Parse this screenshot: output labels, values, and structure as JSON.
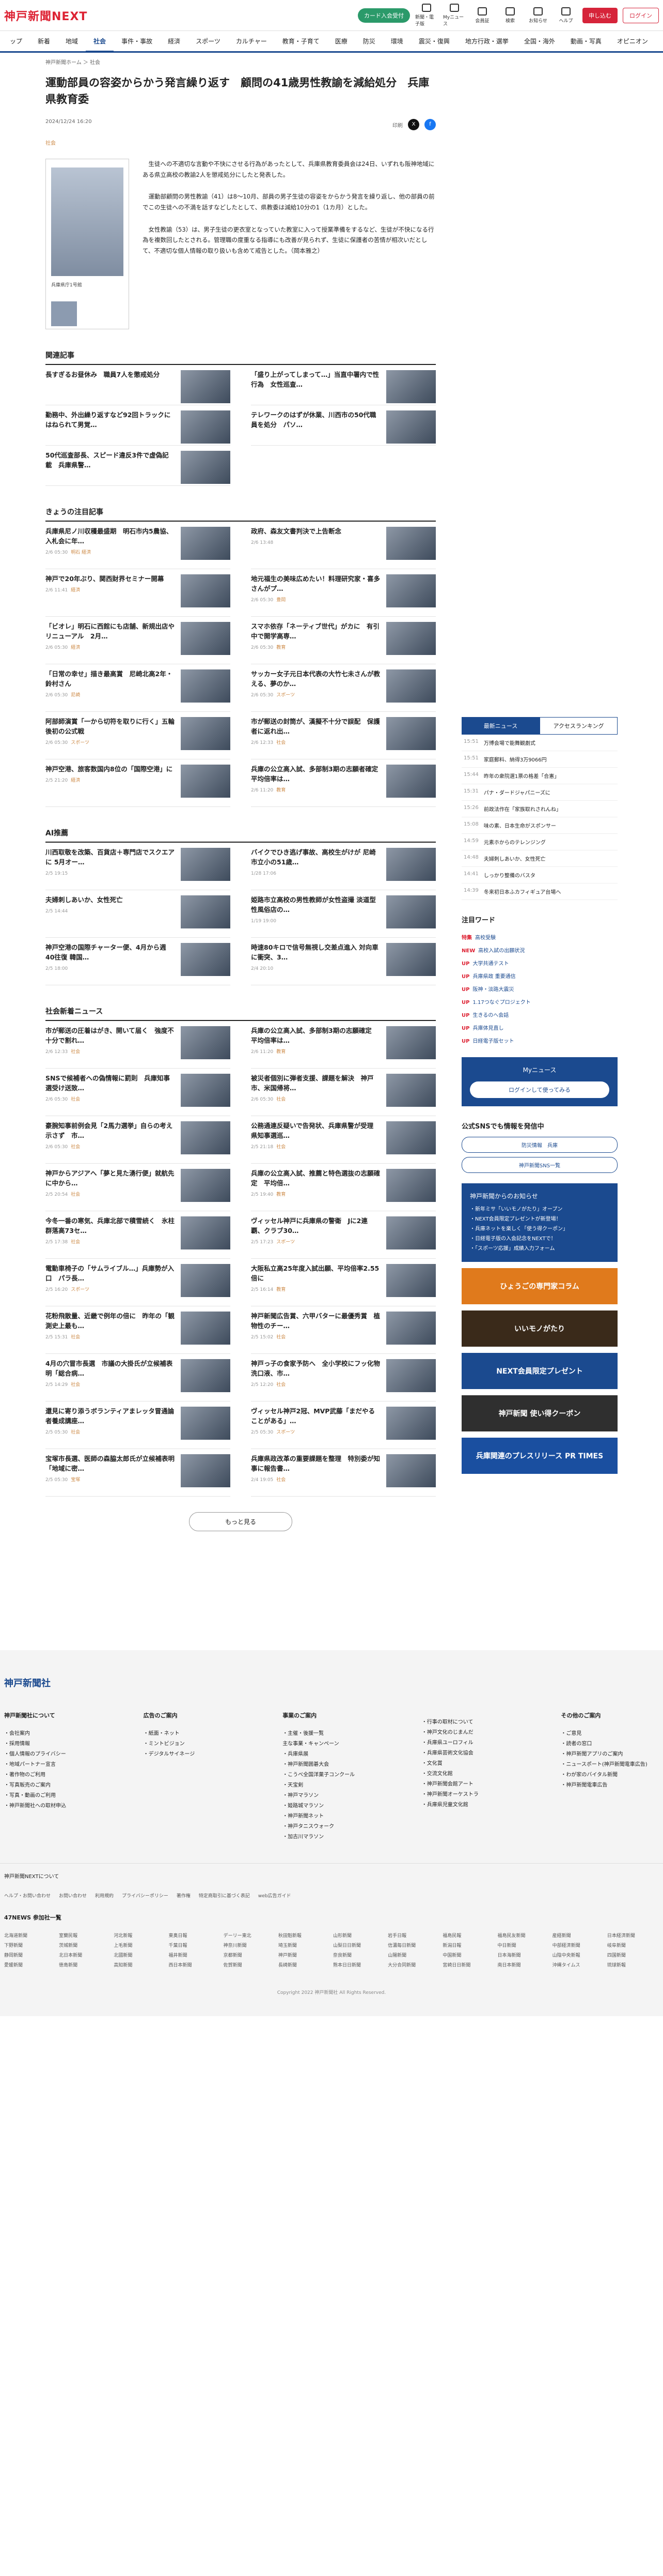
{
  "header": {
    "logo": "神戸新聞",
    "logo_accent": "NEXT",
    "pill": "カード入会受付",
    "icons": [
      {
        "label": "新聞・電子版",
        "icon": "newspaper-icon"
      },
      {
        "label": "Myニュース",
        "icon": "bookmark-icon"
      },
      {
        "label": "会員証",
        "icon": "card-icon"
      },
      {
        "label": "検索",
        "icon": "search-icon"
      },
      {
        "label": "お知らせ",
        "icon": "bell-icon"
      },
      {
        "label": "ヘルプ",
        "icon": "help-icon"
      }
    ],
    "signup": "申し込む",
    "login": "ログイン"
  },
  "nav": [
    "ップ",
    "新着",
    "地域",
    "社会",
    "事件・事故",
    "経済",
    "スポーツ",
    "カルチャー",
    "教育・子育て",
    "医療",
    "防災",
    "環境",
    "震災・復興",
    "地方行政・選挙",
    "全国・海外",
    "動画・写真",
    "オピニオン"
  ],
  "nav_active": "社会",
  "breadcrumb": "神戸新聞ホーム ＞ 社会",
  "article": {
    "title": "運動部員の容姿からかう発言繰り返す　顧問の41歳男性教諭を減給処分　兵庫県教育委",
    "date": "2024/12/24 16:20",
    "tag": "社会",
    "print": "印刷",
    "caption": "兵庫県庁1号館",
    "paragraphs": [
      "生徒への不適切な言動や不快にさせる行為があったとして、兵庫県教育委員会は24日、いずれも阪神地域にある県立高校の教諭2人を懲戒処分にしたと発表した。",
      "運動部顧問の男性教諭（41）は8～10月、部員の男子生徒の容姿をからかう発言を繰り返し、他の部員の前でこの生徒への不満を話すなどしたとして、県教委は減給10分の1（1カ月）とした。",
      "女性教諭（53）は、男子生徒の更衣室となっていた教室に入って授業準備をするなど、生徒が不快になる行為を複数回したとされる。管理職の度重なる指導にも改善が見られず、生徒に保護者の苦情が相次いだとして、不適切な個人情報の取り扱いも含めて戒告とした。（岡本雅之）"
    ]
  },
  "sections": [
    {
      "title": "関連記事",
      "items": [
        {
          "t": "長すぎるお昼休み　職員7人を懲戒処分",
          "d": "",
          "c": ""
        },
        {
          "t": "「盛り上がってしまって…」当直中署内で性行為　女性巡査…",
          "d": "",
          "c": ""
        },
        {
          "t": "勤務中、外出繰り返すなど92回トラックにはねられて男覚…",
          "d": "",
          "c": ""
        },
        {
          "t": "テレワークのはずが休業、川西市の50代職員を処分　パソ…",
          "d": "",
          "c": ""
        },
        {
          "t": "50代巡査部長、スピード違反3件で虚偽記載　兵庫県警…",
          "d": "",
          "c": ""
        }
      ]
    },
    {
      "title": "きょうの注目記事",
      "items": [
        {
          "t": "兵庫県尼ノ川収穫最盛期　明石市内5農協、入札会に年…",
          "d": "2/6 05:30",
          "c": "明石 経済"
        },
        {
          "t": "政府、森友文書判決で上告断念",
          "d": "2/6 13:48",
          "c": ""
        },
        {
          "t": "神戸で20年ぶり、関西財界セミナー開幕",
          "d": "2/6 11:41",
          "c": "経済"
        },
        {
          "t": "地元福生の美味広めたい！料理研究家・喜多さんがプ…",
          "d": "2/6 05:30",
          "c": "豊岡"
        },
        {
          "t": "「ビオレ」明石に西館にも店舗、新規出店やリニューアル　2月…",
          "d": "2/6 05:30",
          "c": "経済"
        },
        {
          "t": "スマホ依存「ネーティブ世代」がカに　有引中で開学高専…",
          "d": "2/6 05:30",
          "c": "教育"
        },
        {
          "t": "「日常の幸せ」描き最高賞　尼崎北高2年・鈴村さん",
          "d": "2/6 05:30",
          "c": "尼崎"
        },
        {
          "t": "サッカー女子元日本代表の大竹七未さんが教える、夢のか…",
          "d": "2/6 05:30",
          "c": "スポーツ"
        },
        {
          "t": "阿部師演賞「一から切符を取りに行く」五輪後初の公式戦",
          "d": "2/6 05:30",
          "c": "スポーツ"
        },
        {
          "t": "市が郵送の封筒が、漢擬不十分で誤配　保護者に返れ出…",
          "d": "2/6 12:33",
          "c": "社会"
        },
        {
          "t": "神戸空港、旅客数国内8位の「国際空港」に",
          "d": "2/5 21:20",
          "c": "経済"
        },
        {
          "t": "兵庫の公立高入試、多部制3期の志願者確定　平均倍率は…",
          "d": "2/6 11:20",
          "c": "教育"
        }
      ]
    },
    {
      "title": "AI推薦",
      "items": [
        {
          "t": "川西取敬を改築、百貨店＋専門店でスクエアに 5月オー…",
          "d": "2/5 19:15",
          "c": ""
        },
        {
          "t": "バイクでひき逃げ事故、高校生がけが 尼崎市立小の51歳…",
          "d": "1/28 17:06",
          "c": ""
        },
        {
          "t": "夫婦刺しあいか、女性死亡",
          "d": "2/5 14:44",
          "c": ""
        },
        {
          "t": "姫路市立高校の男性教師が女性盗撮 淡道型性風俗店の…",
          "d": "1/19 19:00",
          "c": ""
        },
        {
          "t": "神戸空港の国際チャーター便、4月から週40往復 韓国…",
          "d": "2/5 18:00",
          "c": ""
        },
        {
          "t": "時速80キロで信号無視し交差点進入 対向車に衝突、3…",
          "d": "2/4 20:10",
          "c": ""
        }
      ]
    },
    {
      "title": "社会新着ニュース",
      "items": [
        {
          "t": "市が郵送の圧着はがき、開いて届く　強度不十分で割れ…",
          "d": "2/6 12:33",
          "c": "社会"
        },
        {
          "t": "兵庫の公立高入試、多部制3期の志願確定　平均倍率は…",
          "d": "2/6 11:20",
          "c": "教育"
        },
        {
          "t": "SNSで候補者への偽情報に罰則　兵庫知事選受け送致…",
          "d": "2/6 05:30",
          "c": "社会"
        },
        {
          "t": "被災者個別に弾者支援、課題を解決　神戸市、米国帰将…",
          "d": "2/6 05:30",
          "c": "社会"
        },
        {
          "t": "豪腕知事前例会見「2馬力選挙」自らの考え示さず　市…",
          "d": "2/6 05:30",
          "c": "社会"
        },
        {
          "t": "公務通連反疑いで告発状、兵庫県警が受理　県知事選巡…",
          "d": "2/5 21:18",
          "c": "社会"
        },
        {
          "t": "神戸からアジアへ「夢と見た湧行便」就航先に中から…",
          "d": "2/5 20:54",
          "c": "社会"
        },
        {
          "t": "兵庫の公立高入試、推薦と特色選抜の志願確定　平均倍…",
          "d": "2/5 19:40",
          "c": "教育"
        },
        {
          "t": "今冬一番の寒気、兵庫北部で積雪続く　氷柱群落高73セ…",
          "d": "2/5 17:38",
          "c": "社会"
        },
        {
          "t": "ヴィッセル神戸に兵庫県の警衛　Jに2連覇、クラブ30…",
          "d": "2/5 17:23",
          "c": "スポーツ"
        },
        {
          "t": "電動車椅子の「サムライブル…」兵庫勢が入口　パラ長…",
          "d": "2/5 16:20",
          "c": "スポーツ"
        },
        {
          "t": "大阪私立高25年度入試出願、平均倍率2.55倍に",
          "d": "2/5 16:14",
          "c": "教育"
        },
        {
          "t": "花粉飛散量、近畿で例年の倍に　昨年の「観測史上最も…",
          "d": "2/5 15:31",
          "c": "社会"
        },
        {
          "t": "神戸新聞広告賞、六甲バターに最優秀賞　植物性のチー…",
          "d": "2/5 15:02",
          "c": "社会"
        },
        {
          "t": "4月の穴冒市長選　市議の大掛氏が立候補表明「総合病…",
          "d": "2/5 14:29",
          "c": "社会"
        },
        {
          "t": "神戸っ子の食家予防へ　全小学校にフッ化物洗口液、市…",
          "d": "2/5 12:20",
          "c": "社会"
        },
        {
          "t": "還見に寄り添うボランティアまレッタ冒通論者養成講座…",
          "d": "2/5 05:30",
          "c": "社会"
        },
        {
          "t": "ヴィッセル神戸2冠、MVP武藤「まだやることがある」…",
          "d": "2/5 05:30",
          "c": "スポーツ"
        },
        {
          "t": "宝塚市長選、医師の森脇太郎氏が立候補表明「地域に密…",
          "d": "2/5 05:30",
          "c": "宝塚"
        },
        {
          "t": "兵庫県政改革の重要課題を整理　特別委が知事に報告書…",
          "d": "2/4 19:05",
          "c": "社会"
        }
      ]
    }
  ],
  "more": "もっと見る",
  "side": {
    "tabs": [
      "最新ニュース",
      "アクセスランキング"
    ],
    "ranks": [
      {
        "time": "15:51",
        "t": "万博会場で能舞観劇式"
      },
      {
        "time": "15:51",
        "t": "家庭郵料、納得3万9066円"
      },
      {
        "time": "15:44",
        "t": "昨年の衆院選1票の格差「合憲」"
      },
      {
        "time": "15:31",
        "t": "パナ・ダードジャパニーズに"
      },
      {
        "time": "15:26",
        "t": "前政法作在「家族取れされんね」"
      },
      {
        "time": "15:08",
        "t": "味の素、日本生命がスポンサー"
      },
      {
        "time": "14:59",
        "t": "元素ホからのテレンジング"
      },
      {
        "time": "14:48",
        "t": "夫婦刺しあいか、女性死亡"
      },
      {
        "time": "14:41",
        "t": "しっかり整備のバスタ"
      },
      {
        "time": "14:39",
        "t": "冬来初日本ふカフィギュア台場へ"
      }
    ],
    "keywords_title": "注目ワード",
    "keywords": [
      {
        "b": "特集",
        "t": "高校受験"
      },
      {
        "b": "NEW",
        "t": "高校入試の出願状況"
      },
      {
        "b": "UP",
        "t": "大学共通テスト"
      },
      {
        "b": "UP",
        "t": "兵庫県政 重要通信"
      },
      {
        "b": "UP",
        "t": "阪神・淡路大震災"
      },
      {
        "b": "UP",
        "t": "1.17つなぐプロジェクト"
      },
      {
        "b": "UP",
        "t": "生きるのへ会話"
      },
      {
        "b": "UP",
        "t": "兵庫体見直し"
      },
      {
        "b": "UP",
        "t": "日経電子版セット"
      }
    ],
    "my_title": "Myニュース",
    "my_button": "ログインして使ってみる",
    "sns_title": "公式SNSでも情報を発信中",
    "sns_btns": [
      "防災情報　兵庫",
      "神戸新聞SNS一覧"
    ],
    "promo_title": "神戸新聞からのお知らせ",
    "promo": [
      "・新年ミサ「いいモノがたり」オープン",
      "・NEXT会員限定プレゼントが新登場！",
      "・兵庫ネットを楽しく「使う得クーポン」",
      "・日経電子版の入会記念をNEXTで！",
      "・「スポーツ応援」成績入力フォーム"
    ],
    "banners": [
      "ひょうごの専門家コラム",
      "いいモノがたり",
      "NEXT会員限定プレゼント",
      "神戸新聞 使い得クーポン",
      "兵庫関連のプレスリリース PR TIMES"
    ]
  },
  "footer": {
    "logo": "神戸新聞社",
    "cols": [
      {
        "h": "神戸新聞社について",
        "l": [
          "・会社案内",
          "・採用情報",
          "・個人情報のプライバシー",
          "",
          "・地域パートナー宣言",
          "・著作物のご利用",
          "・写真販売のご案内",
          "・写真・動画のご利用",
          "・神戸新聞社への取材申込"
        ]
      },
      {
        "h": "広告のご案内",
        "l": [
          "・紙面・ネット",
          "・ミントビジョン",
          "・デジタルサイネージ"
        ]
      },
      {
        "h": "事業のご案内",
        "l": [
          "・主催・後援一覧",
          "",
          "主な事業・キャンペーン",
          "・兵庫県展",
          "・神戸新聞囲碁大会",
          "・こうべ全国洋菓子コンクール",
          "・天宝剣",
          "・神戸マラソン",
          "・姫路城マラソン",
          "・神戸新聞ネット",
          "・神戸タニスウォーク",
          "・加古川マラソン"
        ]
      },
      {
        "h": "",
        "l": [
          "・行事の取材について",
          "",
          "",
          "・神戸文化のじまんだ",
          "・兵庫県ユーロフィル",
          "・兵庫県芸術文化協会",
          "・文化賞",
          "・交流文化館",
          "・神戸新聞会館アート",
          "・神戸新聞オーケストラ",
          "・兵庫県児童文化館"
        ]
      },
      {
        "h": "その他のご案内",
        "l": [
          "・ご意見",
          "・読者の窓口",
          "・神戸新聞アプリのご案内",
          "・ニュースポート(神戸新聞電車広告)",
          "・わが家のバイタル新聞",
          "・神戸新聞電車広告"
        ]
      }
    ],
    "next_title": "神戸新聞NEXTについて",
    "links": [
      "ヘルプ・お問い合わせ",
      "お問い合わせ",
      "利用規約",
      "プライバシーポリシー",
      "著作権",
      "特定商取引に基づく表記",
      "web広告ガイド"
    ],
    "p47_title": "47NEWS 参加社一覧",
    "p47": [
      "北海道新聞",
      "室蘭民報",
      "河北新報",
      "東奥日報",
      "デーリー東北",
      "秋田魁新報",
      "山形新聞",
      "岩手日報",
      "福島民報",
      "福島民友新聞",
      "産経新聞",
      "日本経済新聞",
      "下野新聞",
      "茨城新聞",
      "上毛新聞",
      "千葉日報",
      "神奈川新聞",
      "埼玉新聞",
      "山梨日日新聞",
      "信濃毎日新聞",
      "新潟日報",
      "中日新聞",
      "中部経済新聞",
      "岐阜新聞",
      "静岡新聞",
      "北日本新聞",
      "北國新聞",
      "福井新聞",
      "京都新聞",
      "神戸新聞",
      "奈良新聞",
      "山陽新聞",
      "中国新聞",
      "日本海新聞",
      "山陰中央新報",
      "四国新聞",
      "愛媛新聞",
      "徳島新聞",
      "高知新聞",
      "西日本新聞",
      "佐賀新聞",
      "長崎新聞",
      "熊本日日新聞",
      "大分合同新聞",
      "宮崎日日新聞",
      "南日本新聞",
      "沖縄タイムス",
      "琉球新報"
    ],
    "copyright": "Copyright 2022 神戸新聞社 All Rights Reserved."
  }
}
